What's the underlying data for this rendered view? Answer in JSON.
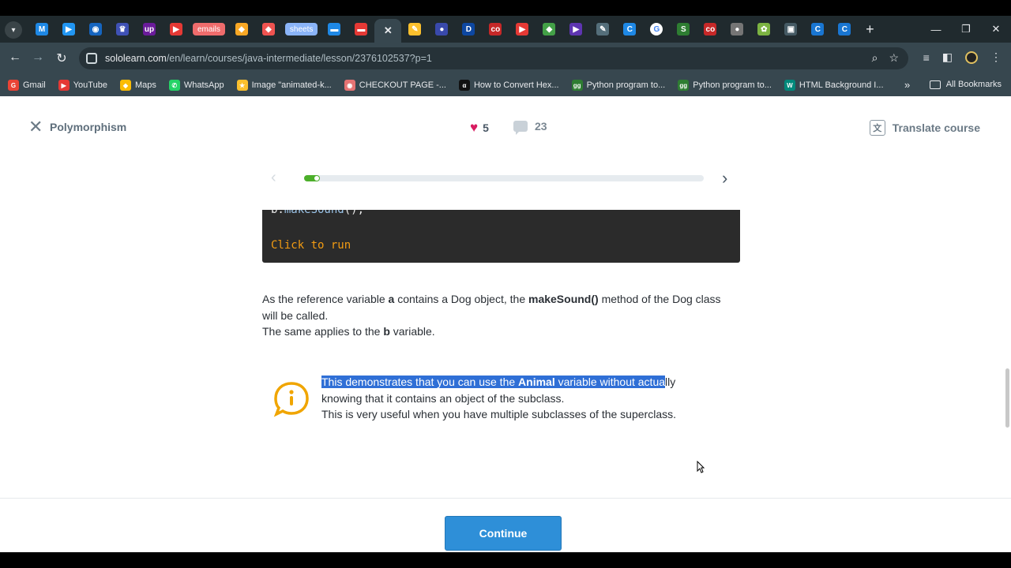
{
  "browser": {
    "tabs": [
      {
        "icon": "gmail-icon",
        "glyph": "M",
        "color": "#1e88e5",
        "kind": "fav"
      },
      {
        "icon": "play-icon",
        "glyph": "▶",
        "color": "#2196f3",
        "kind": "fav"
      },
      {
        "icon": "record-icon",
        "glyph": "◉",
        "color": "#1565c0",
        "kind": "fav"
      },
      {
        "icon": "crown-icon",
        "glyph": "♛",
        "color": "#3f51b5",
        "kind": "fav"
      },
      {
        "icon": "upwork-icon",
        "glyph": "up",
        "color": "#6a1b9a",
        "kind": "fav"
      },
      {
        "icon": "youtube-icon",
        "glyph": "▶",
        "color": "#e53935",
        "kind": "fav"
      },
      {
        "icon": "emails-group",
        "label": "emails",
        "color": "#ef6c6c",
        "kind": "pill"
      },
      {
        "icon": "maps-icon",
        "glyph": "◆",
        "color": "#f9a825",
        "kind": "fav"
      },
      {
        "icon": "maps-icon",
        "glyph": "◆",
        "color": "#ef5350",
        "kind": "fav"
      },
      {
        "icon": "sheets-group",
        "label": "sheets",
        "color": "#8ab4f8",
        "kind": "pill"
      },
      {
        "icon": "docs-icon",
        "glyph": "▬",
        "color": "#1e88e5",
        "kind": "fav"
      },
      {
        "icon": "slides-icon",
        "glyph": "▬",
        "color": "#e53935",
        "kind": "fav"
      },
      {
        "icon": "close-icon",
        "glyph": "✕",
        "color": "#37474f",
        "kind": "active"
      },
      {
        "icon": "pen-icon",
        "glyph": "✎",
        "color": "#fbc02d",
        "kind": "fav"
      },
      {
        "icon": "globe-icon",
        "glyph": "●",
        "color": "#3949ab",
        "kind": "fav"
      },
      {
        "icon": "d-icon",
        "glyph": "D",
        "color": "#0d47a1",
        "kind": "fav"
      },
      {
        "icon": "co-icon",
        "glyph": "co",
        "color": "#c62828",
        "kind": "fav"
      },
      {
        "icon": "youtube-icon",
        "glyph": "▶",
        "color": "#e53935",
        "kind": "fav"
      },
      {
        "icon": "maps-icon",
        "glyph": "◆",
        "color": "#43a047",
        "kind": "fav"
      },
      {
        "icon": "meet-icon",
        "glyph": "▶",
        "color": "#5e35b1",
        "kind": "fav"
      },
      {
        "icon": "draw-icon",
        "glyph": "✎",
        "color": "#546e7a",
        "kind": "fav"
      },
      {
        "icon": "c-icon",
        "glyph": "C",
        "color": "#1e88e5",
        "kind": "fav"
      },
      {
        "icon": "google-icon",
        "glyph": "G",
        "color": "#ffffff",
        "kind": "fav"
      },
      {
        "icon": "s-icon",
        "glyph": "S",
        "color": "#2e7d32",
        "kind": "fav"
      },
      {
        "icon": "co-icon",
        "glyph": "co",
        "color": "#c62828",
        "kind": "fav"
      },
      {
        "icon": "globe-icon",
        "glyph": "●",
        "color": "#757575",
        "kind": "fav"
      },
      {
        "icon": "leaf-icon",
        "glyph": "✿",
        "color": "#7cb342",
        "kind": "fav"
      },
      {
        "icon": "terminal-icon",
        "glyph": "▣",
        "color": "#455a64",
        "kind": "fav"
      },
      {
        "icon": "c-icon",
        "glyph": "C",
        "color": "#1976d2",
        "kind": "fav"
      },
      {
        "icon": "c-icon",
        "glyph": "C",
        "color": "#1976d2",
        "kind": "fav"
      }
    ],
    "new_tab": "+",
    "url_host": "sololearn.com",
    "url_path": "/en/learn/courses/java-intermediate/lesson/2376102537?p=1",
    "bookmarks": [
      {
        "label": "Gmail",
        "color": "#ea4335",
        "glyph": "G"
      },
      {
        "label": "YouTube",
        "color": "#e53935",
        "glyph": "▶"
      },
      {
        "label": "Maps",
        "color": "#fbbc04",
        "glyph": "◆"
      },
      {
        "label": "WhatsApp",
        "color": "#25d366",
        "glyph": "✆"
      },
      {
        "label": "Image \"animated-k...",
        "color": "#fbc02d",
        "glyph": "★"
      },
      {
        "label": "CHECKOUT PAGE -...",
        "color": "#e57373",
        "glyph": "◉"
      },
      {
        "label": "How to Convert Hex...",
        "color": "#111111",
        "glyph": "α"
      },
      {
        "label": "Python program to...",
        "color": "#2e7d32",
        "glyph": "gg"
      },
      {
        "label": "Python program to...",
        "color": "#2e7d32",
        "glyph": "gg"
      },
      {
        "label": "HTML Background I...",
        "color": "#00897b",
        "glyph": "W"
      }
    ],
    "bookmarks_more": "»",
    "all_bookmarks": "All Bookmarks"
  },
  "lesson": {
    "title": "Polymorphism",
    "likes": "5",
    "comments": "23",
    "translate_label": "Translate course",
    "progress": 0.04
  },
  "code": {
    "line_prefix": "b.",
    "line_method": "makeSound",
    "line_suffix": "();",
    "run_label": "Click to run"
  },
  "content": {
    "p1_a": "As the reference variable ",
    "p1_b": "a",
    "p1_c": " contains a Dog object, the ",
    "p1_d": "makeSound()",
    "p1_e": " method of the Dog class will be called.",
    "p2_a": "The same applies to the ",
    "p2_b": "b",
    "p2_c": " variable."
  },
  "note": {
    "sel_a": "This demonstrates that you can use the ",
    "sel_b": "Animal",
    "sel_c": " variable without actua",
    "rest_a": "lly knowing that it contains an object of the subclass.",
    "line2": "This is very useful when you have multiple subclasses of the superclass."
  },
  "footer": {
    "continue_label": "Continue"
  },
  "colors": {
    "accent": "#2e8fd8",
    "progress": "#4caf2a",
    "heart": "#d81b60",
    "info": "#f0a500"
  }
}
